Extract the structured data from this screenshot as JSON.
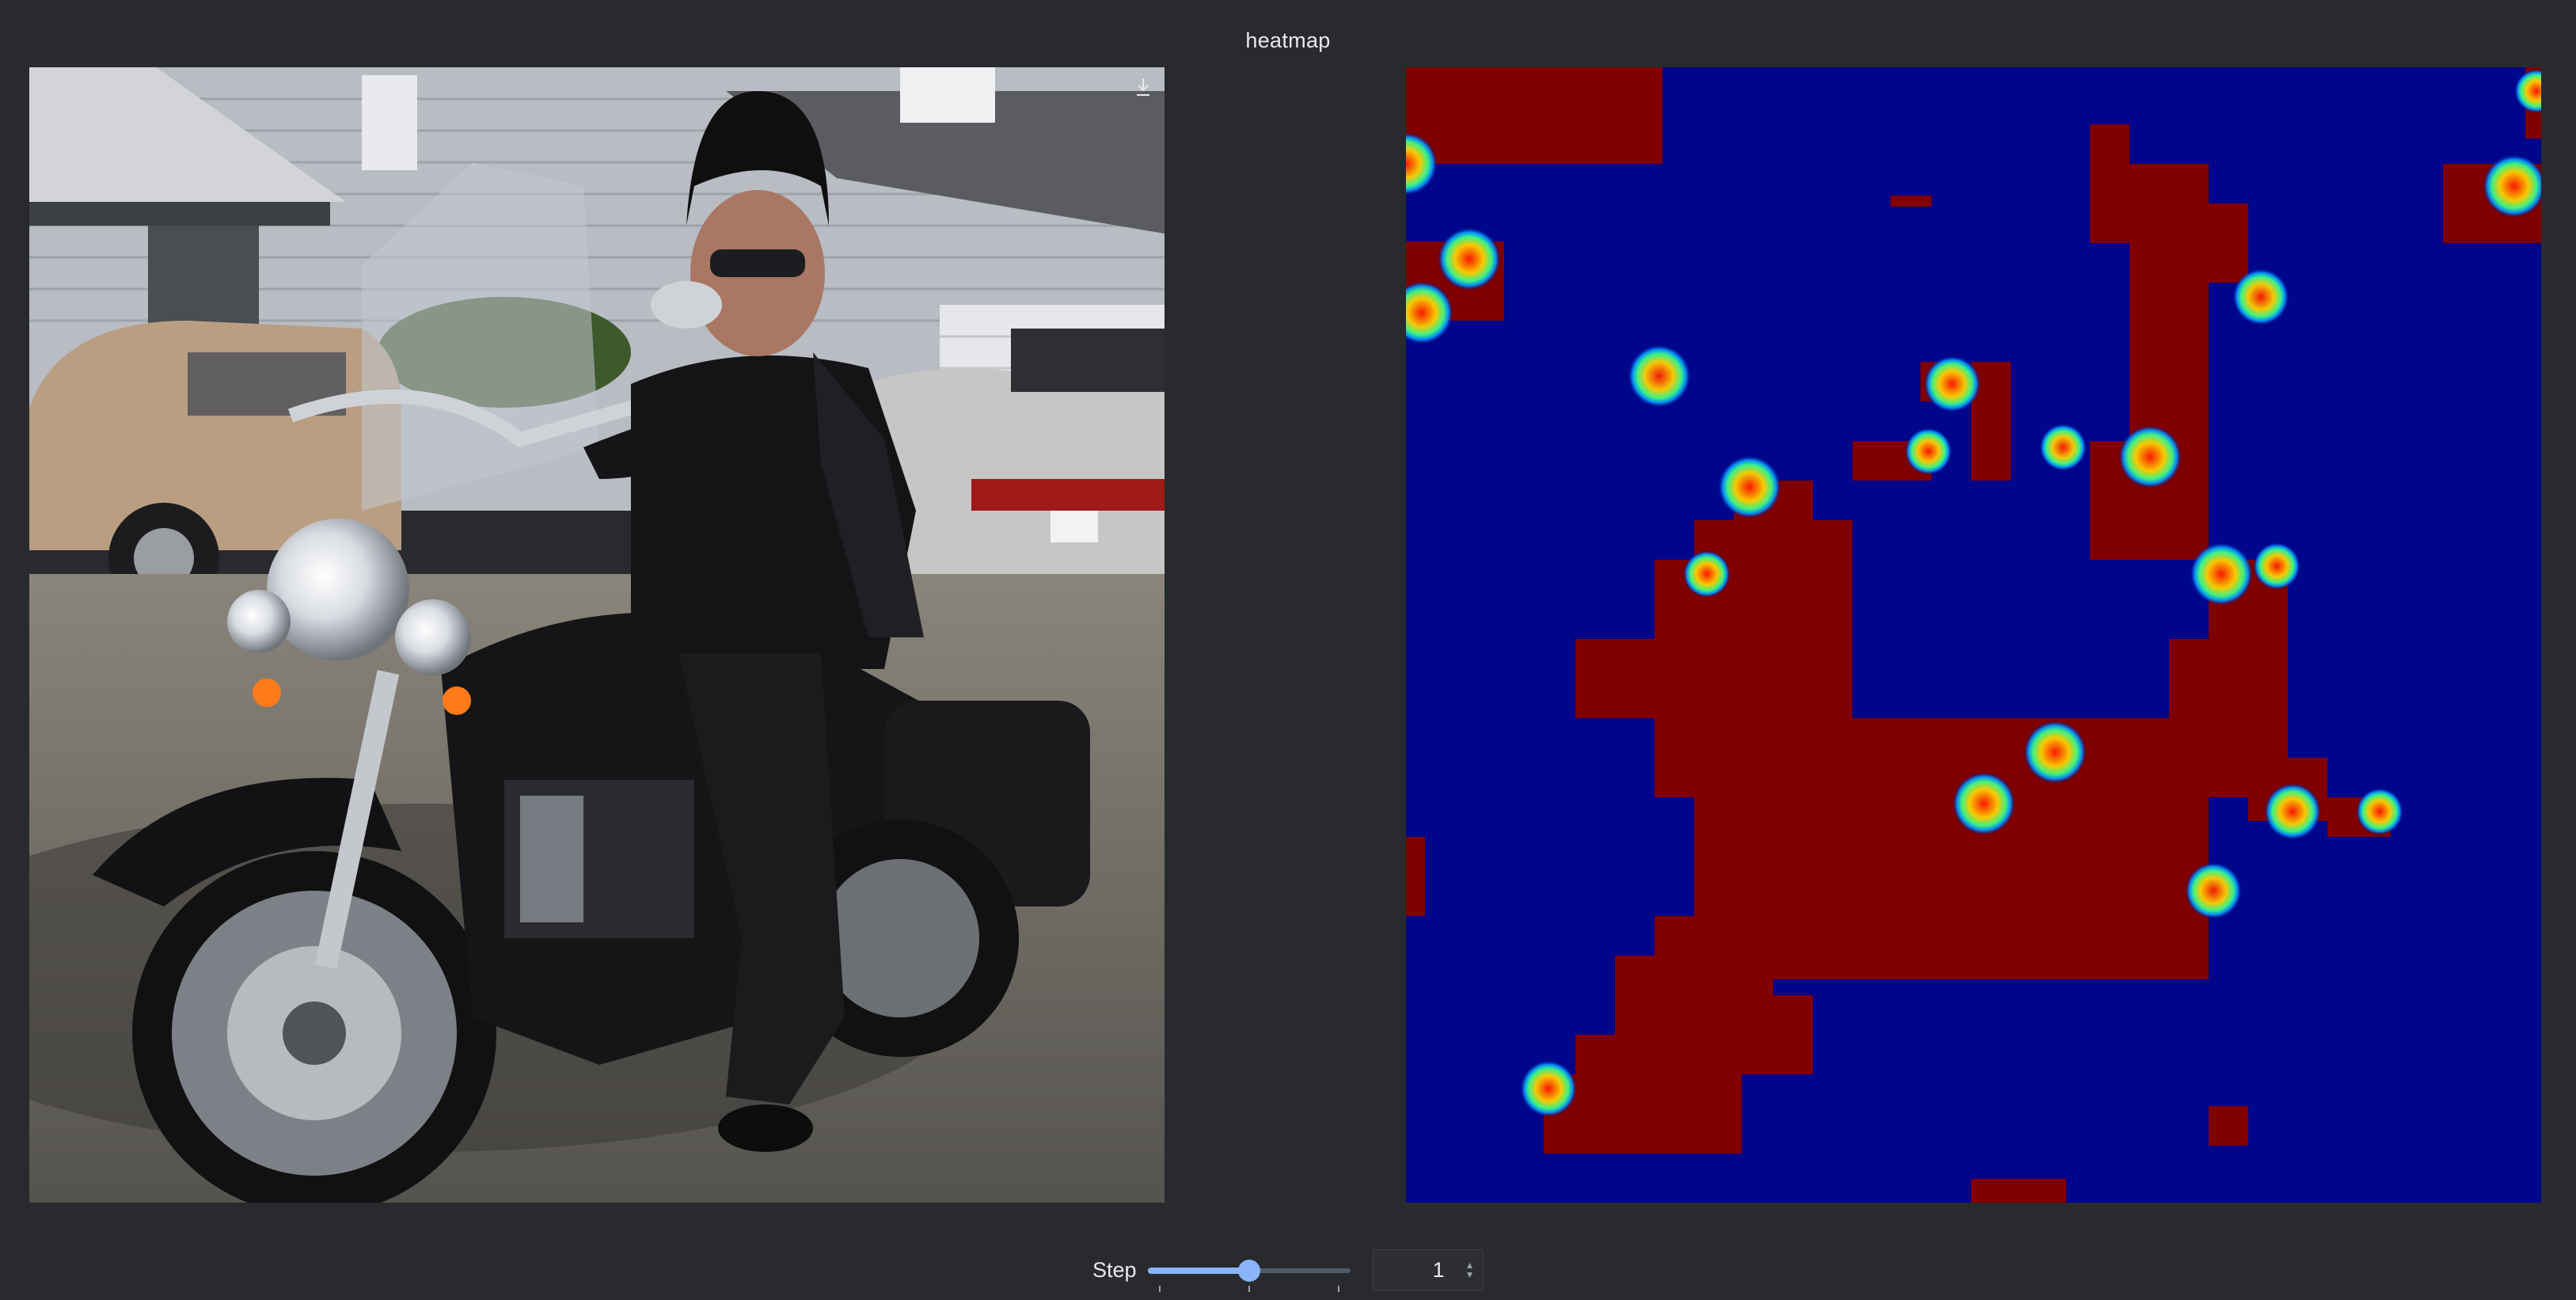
{
  "header": {
    "title": "heatmap"
  },
  "left_panel": {
    "image": "photo of a man in black leather seated on a black motorcycle in a driveway",
    "download_icon": "download-icon"
  },
  "heatmap": {
    "colormap": "jet",
    "background_color": "#00068a",
    "hot_color": "#800000"
  },
  "controls": {
    "step_label": "Step",
    "step_value": "1",
    "slider_fraction": 0.5,
    "slider_color": "#8ab4f8"
  }
}
